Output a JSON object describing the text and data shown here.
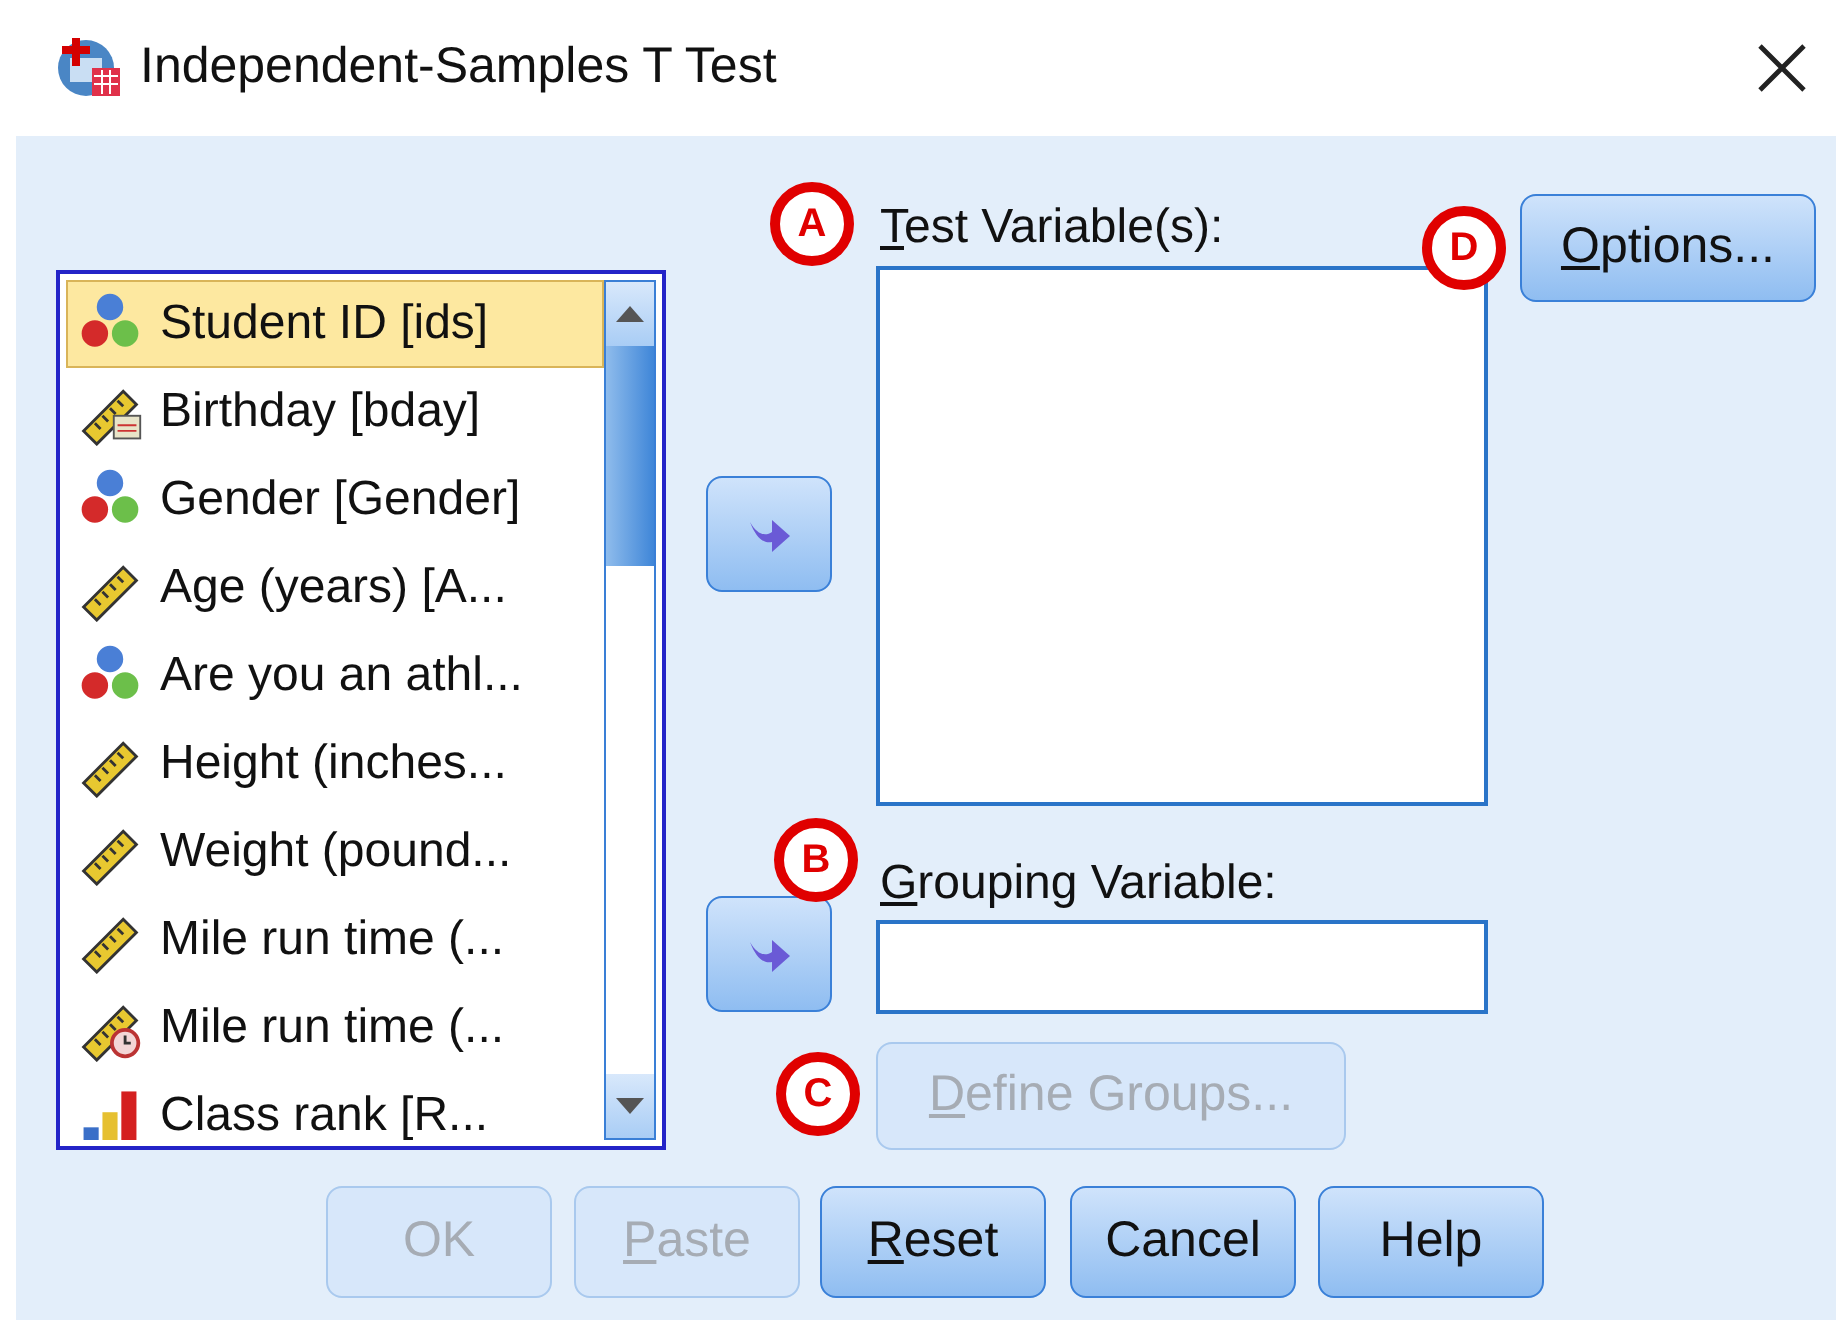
{
  "window": {
    "title": "Independent-Samples T Test"
  },
  "variables": [
    {
      "label": "Student ID [ids]",
      "kind": "nominal",
      "selected": true
    },
    {
      "label": "Birthday [bday]",
      "kind": "date",
      "selected": false
    },
    {
      "label": "Gender [Gender]",
      "kind": "nominal",
      "selected": false
    },
    {
      "label": "Age (years) [A...",
      "kind": "scale",
      "selected": false
    },
    {
      "label": "Are you an athl...",
      "kind": "nominal",
      "selected": false
    },
    {
      "label": "Height (inches...",
      "kind": "scale",
      "selected": false
    },
    {
      "label": "Weight (pound...",
      "kind": "scale",
      "selected": false
    },
    {
      "label": "Mile run time (...",
      "kind": "scale",
      "selected": false
    },
    {
      "label": "Mile run time (...",
      "kind": "time",
      "selected": false
    },
    {
      "label": "Class rank [R...",
      "kind": "ordinal",
      "selected": false
    }
  ],
  "test_variables": {
    "label": "Test Variable(s):",
    "underline_first": true,
    "marker": "A"
  },
  "grouping_variable": {
    "label": "Grouping Variable:",
    "underline_first": true,
    "marker": "B"
  },
  "define_groups": {
    "label": "Define Groups...",
    "underline_first": true,
    "disabled": true,
    "marker": "C"
  },
  "options": {
    "label": "Options...",
    "underline_first": true,
    "disabled": false,
    "marker": "D"
  },
  "buttons": [
    {
      "label": "OK",
      "underline_first": false,
      "disabled": true
    },
    {
      "label": "Paste",
      "underline_first": true,
      "disabled": true
    },
    {
      "label": "Reset",
      "underline_first": true,
      "disabled": false
    },
    {
      "label": "Cancel",
      "underline_first": false,
      "disabled": false
    },
    {
      "label": "Help",
      "underline_first": false,
      "disabled": false
    }
  ]
}
